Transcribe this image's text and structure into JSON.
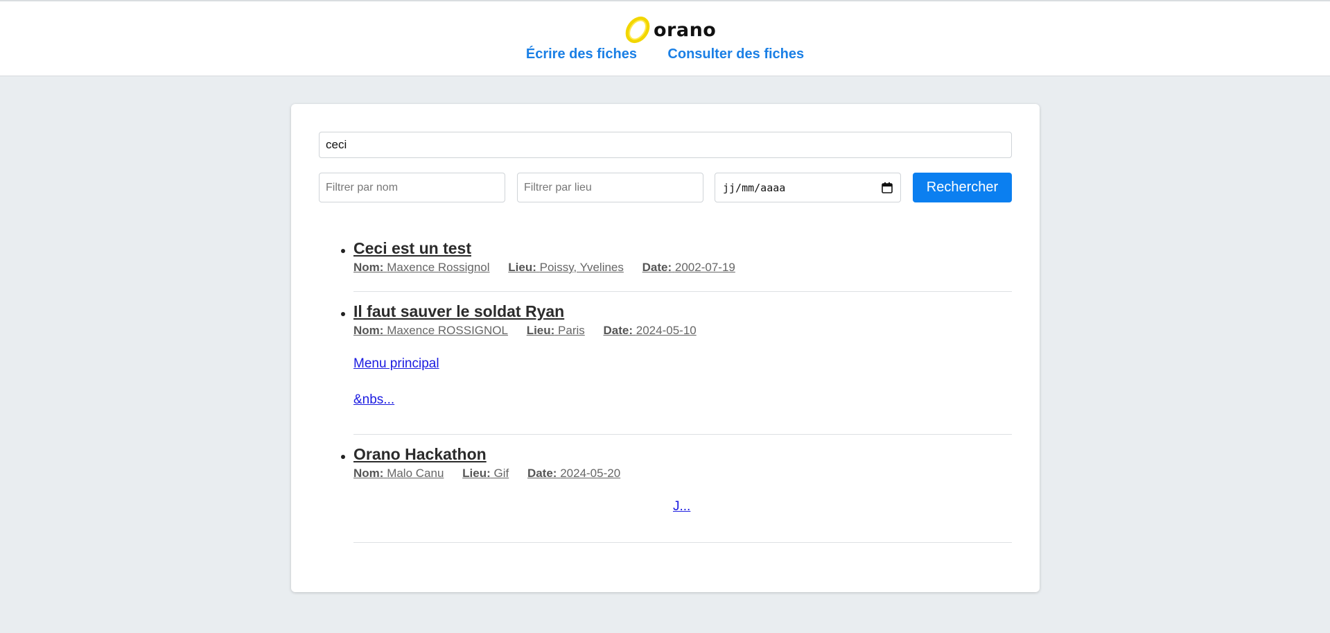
{
  "header": {
    "logo_text": "orano",
    "nav": [
      "Écrire des fiches",
      "Consulter des fiches"
    ],
    "accent": "#1a7fe5"
  },
  "search": {
    "query": "ceci",
    "filter_name_placeholder": "Filtrer par nom",
    "filter_place_placeholder": "Filtrer par lieu",
    "date_placeholder": "jj/mm/aaaa",
    "button": "Rechercher",
    "button_color": "#0b7ff0"
  },
  "labels": {
    "nom": "Nom:",
    "lieu": "Lieu:",
    "date": "Date:"
  },
  "results": [
    {
      "title": "Ceci est un test",
      "nom": "Maxence Rossignol",
      "lieu": "Poissy, Yvelines",
      "date": "2002-07-19",
      "links": []
    },
    {
      "title": "Il faut sauver le soldat Ryan",
      "nom": "Maxence ROSSIGNOL",
      "lieu": "Paris",
      "date": "2024-05-10",
      "links": [
        "Menu principal",
        "&nbs..."
      ]
    },
    {
      "title": "Orano Hackathon",
      "nom": "Malo Canu",
      "lieu": "Gif",
      "date": "2024-05-20",
      "links": [
        "J..."
      ]
    }
  ]
}
